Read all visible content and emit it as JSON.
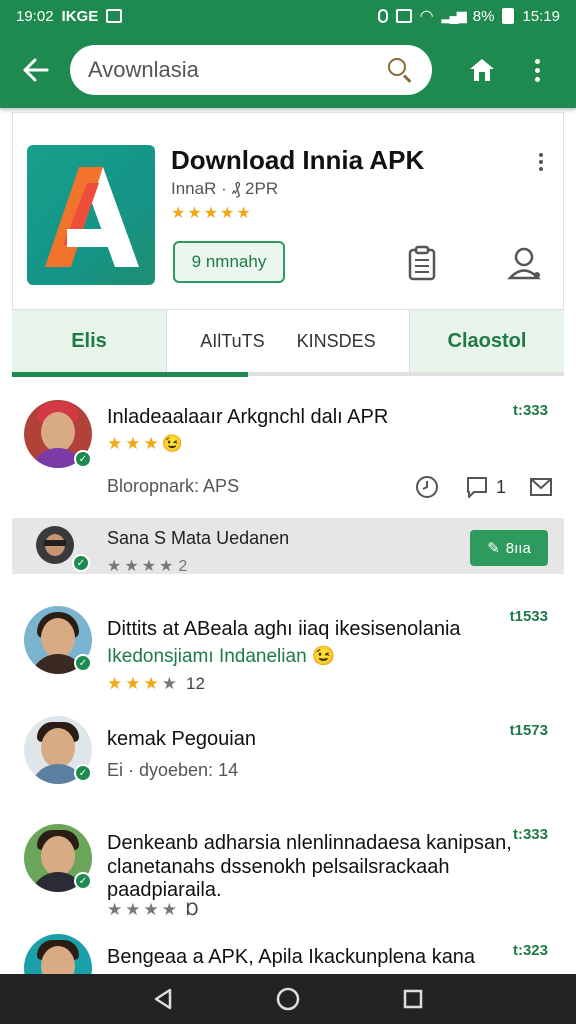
{
  "status_bar": {
    "time": "19:02",
    "left_label": "IKGE",
    "battery": "8%",
    "clock_right": "15:19"
  },
  "search": {
    "value": "Avownlasia"
  },
  "app": {
    "title": "Download Innia APK",
    "meta": "InnaR · ₰ 2PR",
    "stars": "★★★★★",
    "install_label": "9 nmnahy"
  },
  "tabs": {
    "tab1": "Elis",
    "tab2a": "AIlTuTS",
    "tab2b": "KINSDES",
    "tab3": "Claostol"
  },
  "reviews": [
    {
      "title": "Inladeaalaaır Arkgnchl dalı APR",
      "price": "t:333",
      "stars": "★★★",
      "stars_gray": "",
      "emoji": "😉",
      "meta": "Bloropnark: APS",
      "comment_count": "1"
    },
    {
      "title": "Dittits at ABeala aghı iiaq ikesisenolania",
      "subtitle": "Ikedonsjiamı Indanelian 😉",
      "price": "t1533",
      "stars": "★★★",
      "stars_gray": "★",
      "rating_count": "12"
    },
    {
      "title": "kemak Pegouian",
      "meta": "Ei · dyoeben: 14",
      "price": "t1573"
    },
    {
      "title": "Denkeanb adharsia nlenlinnadaesa kanipsan,",
      "title2": "clanetanahs dssenokh pelsailsrackaah paadpiaraila.",
      "price": "t:333",
      "stars_gray": "★★★★",
      "rating_count": "Ɒ"
    },
    {
      "title": "Bengeaa a APK, Apila Ikackunplena kana",
      "price": "t:323"
    }
  ],
  "highlight": {
    "title": "Sana S Mata Uedanen",
    "stars": "★★★★",
    "count": "2",
    "button_label": "8ııa"
  },
  "colors": {
    "primary": "#1e8a4f",
    "star": "#f0a818"
  }
}
